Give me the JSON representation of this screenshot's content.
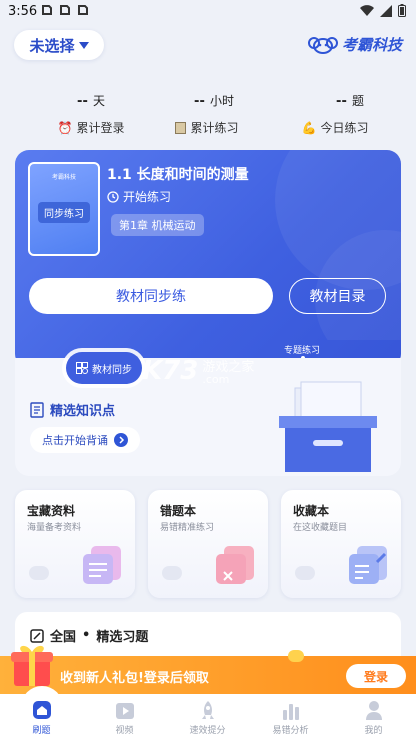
{
  "status": {
    "time": "3:56"
  },
  "header": {
    "selector_label": "未选择",
    "brand": "考霸科技"
  },
  "stats": [
    {
      "value": "--",
      "unit": "天",
      "label": "累计登录",
      "icon": "alarm-clock-icon"
    },
    {
      "value": "--",
      "unit": "小时",
      "label": "累计练习",
      "icon": "notebook-icon"
    },
    {
      "value": "--",
      "unit": "题",
      "label": "今日练习",
      "icon": "flex-arm-icon"
    }
  ],
  "hero": {
    "book_publisher": "考霸科技",
    "book_label": "同步练习",
    "lesson_title": "1.1 长度和时间的测量",
    "start_label": "开始练习",
    "chapter": "第1章  机械运动",
    "btn_sync": "教材同步练",
    "btn_toc": "教材目录"
  },
  "tabs": {
    "sync": "教材同步",
    "topic": "专题练习"
  },
  "knowledge": {
    "title": "精选知识点",
    "button": "点击开始背诵"
  },
  "watermark": {
    "main": "K73",
    "sub": "游戏之家",
    "domain": ".com"
  },
  "cards": [
    {
      "title": "宝藏资料",
      "subtitle": "海量备考资料"
    },
    {
      "title": "错题本",
      "subtitle": "易错精准练习"
    },
    {
      "title": "收藏本",
      "subtitle": "在这收藏题目"
    }
  ],
  "section": {
    "region": "全国",
    "dot": "•",
    "title": "精选习题"
  },
  "promo": {
    "text": "收到新人礼包!登录后领取",
    "button": "登录"
  },
  "tabbar": [
    {
      "label": "刷题",
      "icon": "home-icon",
      "active": true
    },
    {
      "label": "视频",
      "icon": "video-icon",
      "active": false
    },
    {
      "label": "速效提分",
      "icon": "rocket-icon",
      "active": false
    },
    {
      "label": "易错分析",
      "icon": "bar-chart-icon",
      "active": false
    },
    {
      "label": "我的",
      "icon": "person-icon",
      "active": false
    }
  ],
  "colors": {
    "accent": "#3f60e0",
    "promo": "#ff9a2a"
  }
}
